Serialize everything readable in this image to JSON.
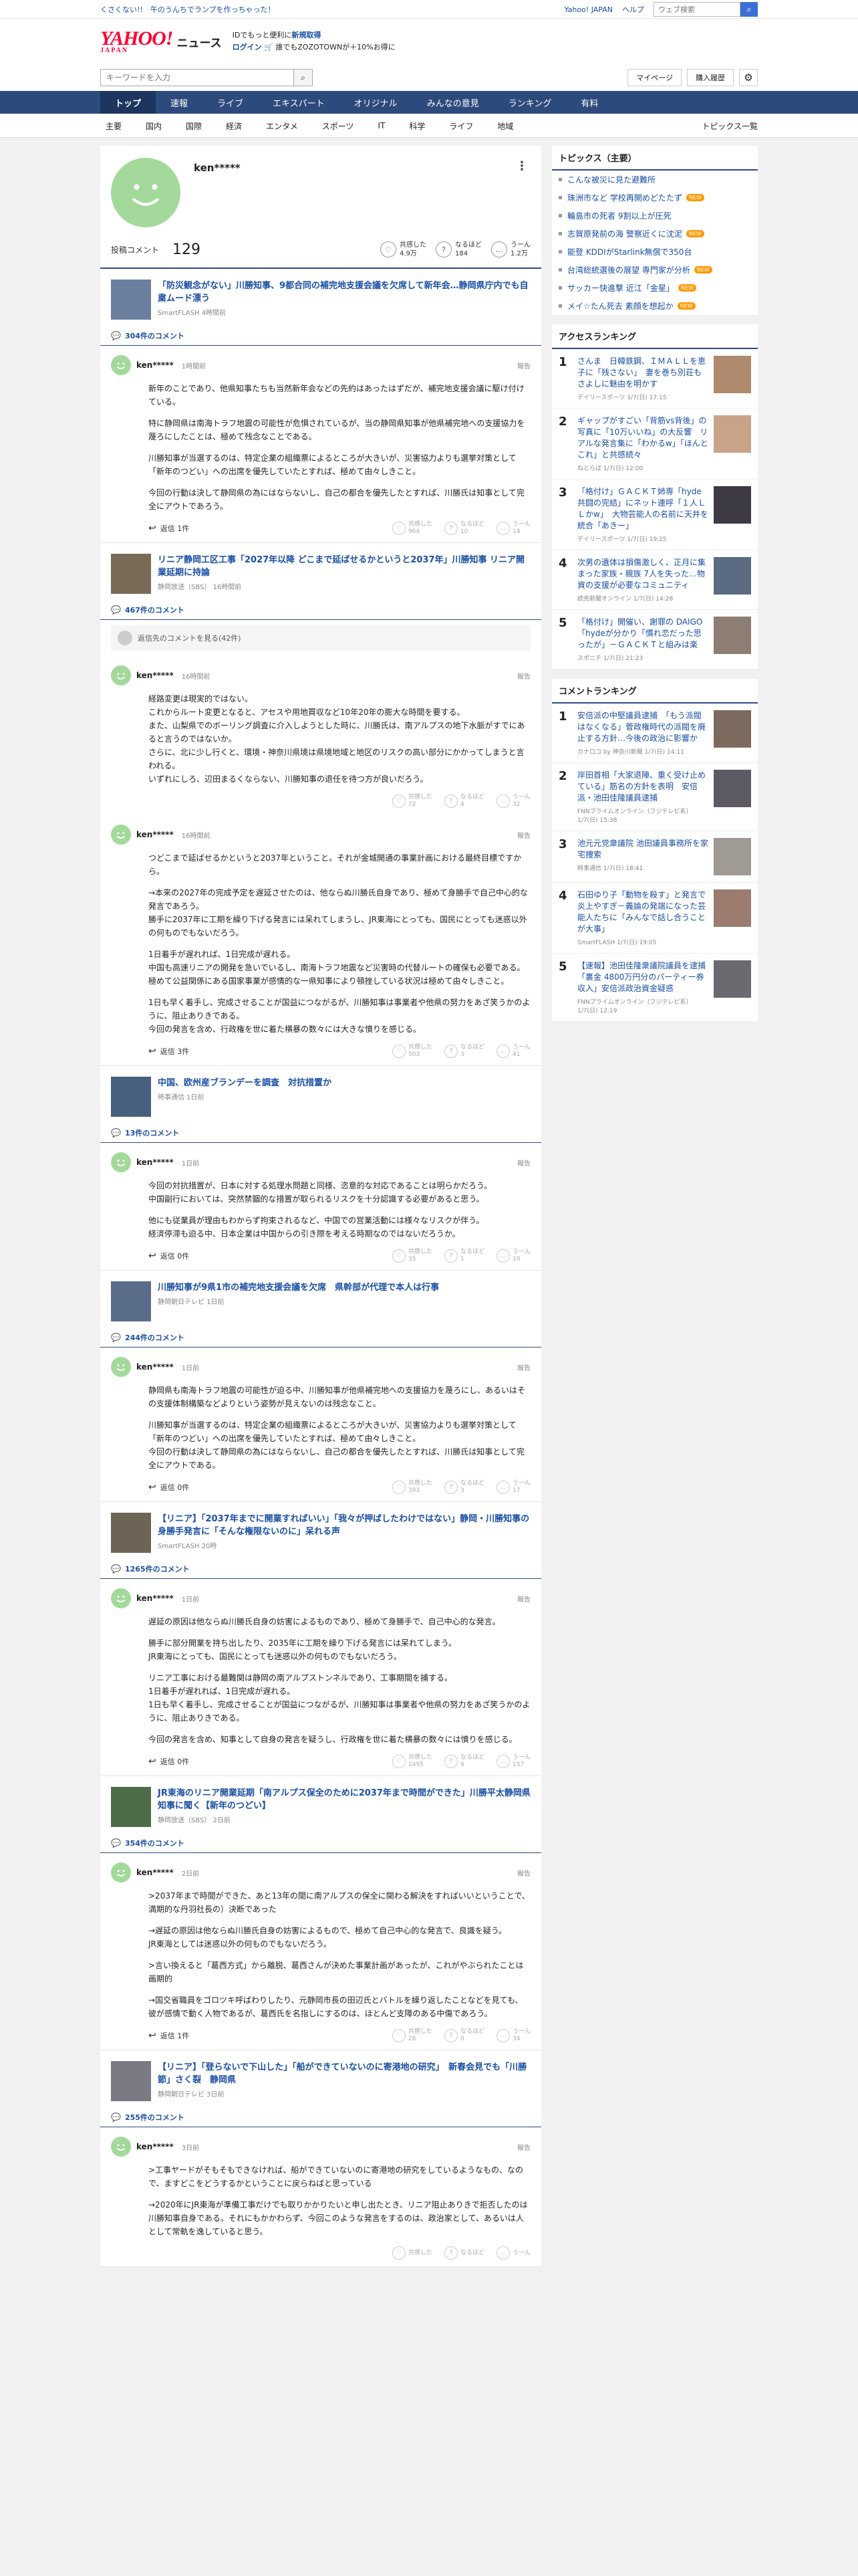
{
  "promo": {
    "text": "くさくない!!　午のうんちでランプを作っちゃった！"
  },
  "top_links": {
    "home": "Yahoo! JAPAN",
    "help": "ヘルプ",
    "search_placeholder": "ウェブ検索"
  },
  "header": {
    "logo": "YAHOO!",
    "logo_sub": "JAPAN",
    "service": "ニュース",
    "id_line_1": "IDでもっと便利に",
    "id_line_1_blue": "新規取得",
    "id_line_2_blue": "ログイン",
    "id_line_2": "🛒 誰でもZOZOTOWNが＋10%お得に"
  },
  "search": {
    "placeholder": "キーワードを入力",
    "mypage": "マイページ",
    "purchase_history": "購入履歴"
  },
  "mainnav": [
    "トップ",
    "速報",
    "ライブ",
    "エキスパート",
    "オリジナル",
    "みんなの意見",
    "ランキング",
    "有料"
  ],
  "subnav": [
    "主要",
    "国内",
    "国際",
    "経済",
    "エンタメ",
    "スポーツ",
    "IT",
    "科学",
    "ライフ",
    "地域"
  ],
  "subnav_ranking": "トピックス一覧",
  "profile": {
    "name": "ken*****",
    "stat_label": "投稿コメント",
    "stat_count": "129",
    "reactions": [
      {
        "label": "共感した",
        "count": "4.9万"
      },
      {
        "label": "なるほど",
        "count": "184"
      },
      {
        "label": "うーん",
        "count": "1.2万"
      }
    ]
  },
  "articles": [
    {
      "title": "「防災観念がない」川勝知事、9都合同の補完地支援会議を欠席して新年会…静岡県庁内でも自粛ムード漂う",
      "source": "SmartFLASH 4時間前",
      "comment_count": "304件のコメント",
      "comments": [
        {
          "user": "ken*****",
          "time": "1時間前",
          "body": [
            "新年のことであり、他県知事たちも当然新年会などの先約はあったはずだが、補完地支援会議に駆け付けている。",
            "特に静岡県は南海トラフ地震の可能性が危惧されているが、当の静岡県知事が他県補完地への支援協力を蔑ろにしたことは、極めて残念なことである。",
            "川勝知事が当選するのは、特定企業の組織票によるところが大きいが、災害協力よりも選挙対策として「新年のつどい」への出席を優先していたとすれば、極めて由々しきこと。",
            "今回の行動は決して静岡県の為にはならないし、自己の都合を優先したとすれば、川勝氏は知事として完全にアウトであろう。"
          ],
          "replies": "返信 1件",
          "reacts": [
            "964",
            "10",
            "14"
          ]
        }
      ]
    },
    {
      "title": "リニア静岡工区工事「2027年以降 どこまで延ばせるかというと2037年」川勝知事 リニア開業延期に持論",
      "source": "静岡放送（SBS） 16時間前",
      "comment_count": "467件のコメント",
      "reply_note": "返信先のコメントを見る(42件)",
      "comments": [
        {
          "user": "ken*****",
          "time": "16時間前",
          "body": [
            "経路変更は現実的ではない。\nこれからルート変更となると、アセスや用地買収など10年20年の膨大な時間を要する。\nまた、山梨県でのボーリング調査に介入しようとした時に、川勝氏は、南アルプスの地下水脈がすでにあると言うのではないか。\nさらに、北に少し行くと、環境・神奈川県境は県境地域と地区のリスクの高い部分にかかってしまうと言われる。\nいずれにしろ、辺田まるくならない、川勝知事の退任を待つ方が良いだろう。"
          ],
          "replies": "",
          "reacts": [
            "72",
            "4",
            "32"
          ]
        },
        {
          "user": "ken*****",
          "time": "16時間前",
          "body": [
            "つどこまで延ばせるかというと2037年ということ。それが金城開通の事業計画における最終目標ですから。",
            "→本来の2027年の完成予定を遅延させたのは、他ならぬ川勝氏自身であり、極めて身勝手で自己中心的な発言であろう。\n勝手に2037年に工期を繰り下げる発言には呆れてしまうし、JR東海にとっても、国民にとっても迷惑以外の何ものでもないだろう。",
            "1日着手が遅れれば、1日完成が遅れる。\n中国も高速リニアの開発を急いでいるし、南海トラフ地震など災害時の代替ルートの確保も必要である。極めて公益関係にある国家事業が感情的な一県知事により頓挫している状況は極めて由々しきこと。",
            "1日も早く着手し、完成させることが国益につながるが、川勝知事は事業者や他県の努力をあざ笑うかのように、阻止ありきである。\n今回の発言を含め、行政権を世に着た横暴の数々には大きな憤りを感じる。"
          ],
          "replies": "返信 3件",
          "reacts": [
            "503",
            "3",
            "41"
          ]
        }
      ]
    },
    {
      "title": "中国、欧州産ブランデーを調査　対抗措置か",
      "source": "時事通信 1日前",
      "comment_count": "13件のコメント",
      "comments": [
        {
          "user": "ken*****",
          "time": "1日前",
          "body": [
            "今回の対抗措置が、日本に対する処理水問題と同様、恣意的な対応であることは明らかだろう。\n中国副行においては、突然禁錮的な措置が取られるリスクを十分認識する必要があると思う。",
            "他にも従業員が理由もわからず拘束されるなど、中国での営業活動には様々なリスクが伴う。\n経済停滞も迫る中、日本企業は中国からの引き際を考える時期なのではないだろうか。"
          ],
          "replies": "返信 0件",
          "reacts": [
            "35",
            "1",
            "10"
          ]
        }
      ]
    },
    {
      "title": "川勝知事が9県1市の補完地支援会議を欠席　県幹部が代理で本人は行事",
      "source": "静岡朝日テレビ 1日前",
      "comment_count": "244件のコメント",
      "comments": [
        {
          "user": "ken*****",
          "time": "1日前",
          "body": [
            "静岡県も南海トラフ地震の可能性が迫る中、川勝知事が他県補完地への支援協力を蔑ろにし、あるいはその支援体制構築などよりという姿勢が見えないのは残念なこと。",
            "川勝知事が当選するのは、特定企業の組織票によるところが大きいが、災害協力よりも選挙対策として「新年のつどい」への出席を優先していたとすれば、極めて由々しきこと。\n今回の行動は決して静岡県の為にはならないし、自己の都合を優先したとすれば、川勝氏は知事として完全にアウトである。"
          ],
          "replies": "返信 0件",
          "reacts": [
            "393",
            "3",
            "17"
          ]
        }
      ]
    },
    {
      "title": "【リニア】「2037年までに開業すればいい」「我々が押ばしたわけではない」静岡・川勝知事の身勝手発言に「そんな権限ないのに」呆れる声",
      "source": "SmartFLASH 20時",
      "comment_count": "1265件のコメント",
      "comments": [
        {
          "user": "ken*****",
          "time": "1日前",
          "body": [
            "遅延の原因は他ならぬ川勝氏自身の妨害によるものであり、極めて身勝手で、自己中心的な発言。",
            "勝手に部分開業を持ち出したり、2035年に工期を繰り下げる発言には呆れてしまう。\nJR東海にとっても、国民にとっても迷惑以外の何ものでもないだろう。",
            "リニア工事における最難関は静岡の南アルプストンネルであり、工事期間を捕する。\n1日着手が遅れれば、1日完成が遅れる。\n1日も早く着手し、完成させることが国益につながるが、川勝知事は事業者や他県の努力をあざ笑うかのように、阻止ありきである。",
            "今回の発言を含め、知事として自身の発言を疑うし、行政権を世に着た横暴の数々には憤りを感じる。"
          ],
          "replies": "返信 0件",
          "reacts": [
            "2495",
            "9",
            "157"
          ]
        }
      ]
    },
    {
      "title": "JR東海のリニア開業延期「南アルプス保全のために2037年まで時間ができた」川勝平太静岡県知事に聞く【新年のつどい】",
      "source": "静岡放送（SBS） 2日前",
      "comment_count": "354件のコメント",
      "comments": [
        {
          "user": "ken*****",
          "time": "2日前",
          "body": [
            ">2037年まで時間ができた、あと13年の間に南アルプスの保全に関わる解決をすればいいということで、満期的な丹羽社長の）決断であった",
            "→遅延の原因は他ならぬ川勝氏自身の妨害によるもので、極めて自己中心的な発言で、良識を疑う。\nJR東海としては迷惑以外の何ものでもないだろう。",
            ">言い換えると「葛西方式」から離脱、葛西さんが決めた事業計画があったが、これがやぶられたことは画期的",
            "→国交省職員をゴロツキ呼ばわりしたり、元静岡市長の田辺氏とバトルを繰り返したことなどを見ても、彼が感情で動く人物であるが、葛西氏を名指しにするのは、ほとんど支障のある中傷であろう。"
          ],
          "replies": "返信 1件",
          "reacts": [
            "28",
            "0",
            "34"
          ]
        }
      ]
    },
    {
      "title": "【リニア】「登らないで下山した」「船ができていないのに寄港地の研究」　新春会見でも「川勝節」さく裂　静岡県",
      "source": "静岡朝日テレビ 3日前",
      "comment_count": "255件のコメント",
      "comments": [
        {
          "user": "ken*****",
          "time": "3日前",
          "body": [
            ">工事ヤードがそもそもできなければ、船ができていないのに寄港地の研究をしているようなもの、なので、ますどこをどうするかということに戻らねばと思っている",
            "→2020年にJR東海が準備工事だけでも取りかかりたいと申し出たとき、リニア阻止ありきで拒否したのは川勝知事自身である。それにもかかわらず、今回このような発言をするのは、政治家として、あるいは人として常軌を逸していると思う。"
          ],
          "replies": "",
          "reacts": [
            "",
            "",
            ""
          ]
        }
      ]
    }
  ],
  "sidebar": {
    "topics_title": "トピックス（主要）",
    "topics": [
      {
        "text": "こんな被災に見た避難所",
        "new": ""
      },
      {
        "text": "珠洲市など 学校再開めどたたず",
        "new": "NEW"
      },
      {
        "text": "輪島市の死者 9割以上が圧死",
        "new": ""
      },
      {
        "text": "志賀原発前の海 警察近くに沈泥",
        "new": "NEW"
      },
      {
        "text": "能登 KDDIがStarlink無償で350台",
        "new": ""
      },
      {
        "text": "台湾総統選後の展望 専門家が分析",
        "new": "NEW"
      },
      {
        "text": "サッカー快進撃 近江「金星」",
        "new": "NEW"
      },
      {
        "text": "メイ☆たん死去 素顔を想起か",
        "new": "NEW"
      }
    ],
    "access_title": "アクセスランキング",
    "access": [
      {
        "num": "1",
        "title": "さんま　日韓鉄鋼、ＩＭＡＬＬを恵子に「残さない」　妻を巻ち別荘も　さよしに魅由を明かす",
        "src": "デイリースポーツ 1/7(日) 17:15"
      },
      {
        "num": "2",
        "title": "ギャップがすごい「背筋vs背後」の写真に「10万いいね」の大反響　リアルな発言集に「わかるw」「ほんとこれ」と共感続々",
        "src": "ねとらぼ 1/7(日) 12:00"
      },
      {
        "num": "3",
        "title": "「格付け」ＧＡＣＫＴ姉専「hyde共闘の完結」にネット連呼「１人ＬＬかw」　大物芸能人の名前に天井を統合「あきー」",
        "src": "デイリースポーツ 1/7(日) 19:25"
      },
      {
        "num": "4",
        "title": "次男の遺体は損傷激しく、正月に集まった家族・親族 7人を失った…物資の支援が必要なコミュニティ",
        "src": "読売新聞オンライン 1/7(日) 14:28"
      },
      {
        "num": "5",
        "title": "「格付け」開催い、謝罪の DAIGO「hydeが分かり「慣れ恋だった思ったが」－ＧＡＣＫＴと組みは楽",
        "src": "スポニチ 1/7(日) 21:23"
      }
    ],
    "comment_title": "コメントランキング",
    "comment_ranking": [
      {
        "num": "1",
        "title": "安倍派の中堅議員逮捕　「もう派閥はなくなる」菅政権時代の派閥を廃止する方針…今後の政治に影響か",
        "src": "カナロコ by 神奈川新聞 1/7(日) 14:11"
      },
      {
        "num": "2",
        "title": "岸田首相「大家退陣、重く受け止めている」筋名の方針を表明　安倍派・池田佳隆議員逮捕",
        "src": "FNNプライムオンライン（フジテレビ系） 1/7(日) 15:38"
      },
      {
        "num": "3",
        "title": "池元元党衆議院 池田議員事務所を家宅捜索",
        "src": "時事通信 1/7(日) 18:41"
      },
      {
        "num": "4",
        "title": "石田ゆり子「動物を殺す」と発言で炎上やすぎ－義論の発端になった芸能人たちに「みんなで話し合うことが大事」",
        "src": "SmartFLASH 1/7(日) 19:05"
      },
      {
        "num": "5",
        "title": "【速報】池田佳隆衆議院議員を逮捕　「裏金 4800万円分のパーティー券収入」安倍派政治資金疑惑",
        "src": "FNNプライムオンライン（フジテレビ系） 1/7(日) 12:19"
      }
    ]
  }
}
